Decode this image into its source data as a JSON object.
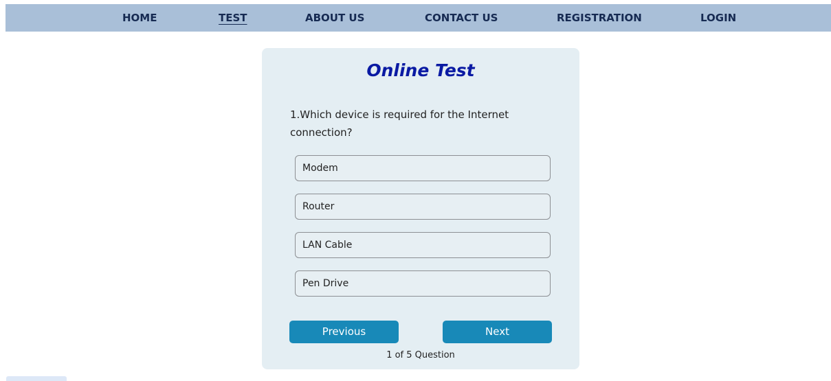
{
  "nav": {
    "items": [
      {
        "label": "HOME"
      },
      {
        "label": "TEST"
      },
      {
        "label": "ABOUT US"
      },
      {
        "label": "CONTACT US"
      },
      {
        "label": "REGISTRATION"
      },
      {
        "label": "LOGIN"
      }
    ],
    "active": "TEST"
  },
  "quiz": {
    "title": "Online Test",
    "question": "1.Which device is required for the Internet connection?",
    "options": [
      {
        "label": "Modem"
      },
      {
        "label": "Router"
      },
      {
        "label": "LAN Cable"
      },
      {
        "label": "Pen Drive"
      }
    ],
    "previous_label": "Previous",
    "next_label": "Next",
    "counter": "1 of 5 Question"
  },
  "colors": {
    "nav_bg": "#a9bfd8",
    "nav_text": "#162a52",
    "card_bg": "#e4eef3",
    "title": "#0a1aa3",
    "button": "#1889b8"
  }
}
